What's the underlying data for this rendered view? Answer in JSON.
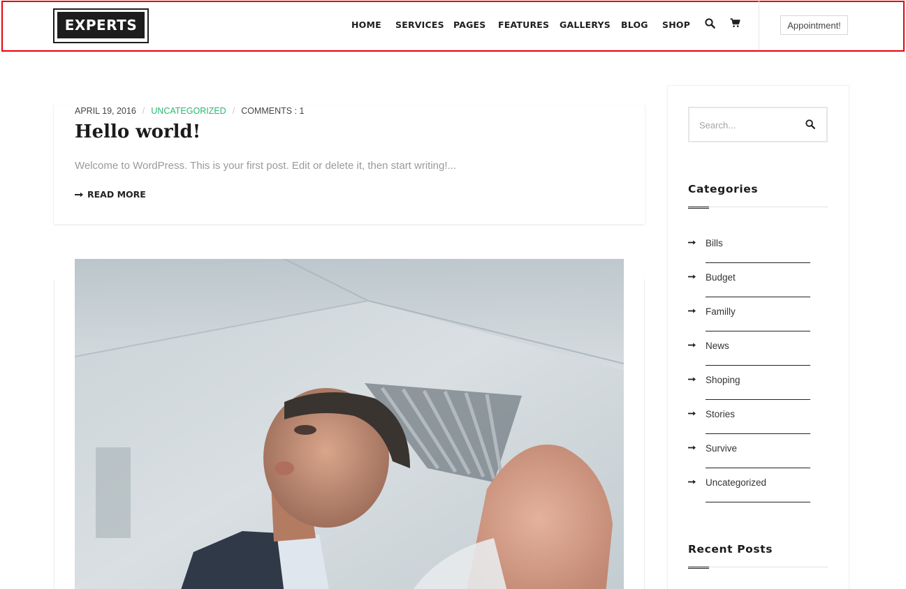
{
  "header": {
    "logo_text": "EXPERTS",
    "nav": [
      "HOME",
      "SERVICES",
      "PAGES",
      "FEATURES",
      "GALLERYS",
      "BLOG",
      "SHOP"
    ],
    "search_icon": "search-icon",
    "cart_icon": "cart-icon",
    "appointment_label": "Appointment!",
    "highlight_color": "#e8000b"
  },
  "post": {
    "date": "APRIL 19, 2016",
    "category": "UNCATEGORIZED",
    "comments": "COMMENTS : 1",
    "title": "Hello world!",
    "excerpt": "Welcome to WordPress. This is your first post. Edit or delete it, then start writing!...",
    "read_more": "READ MORE",
    "category_color": "#2bb673"
  },
  "post2": {
    "image_desc": "businessman-photo"
  },
  "sidebar": {
    "search_placeholder": "Search...",
    "categories_title": "Categories",
    "categories": [
      "Bills",
      "Budget",
      "Familly",
      "News",
      "Shoping",
      "Stories",
      "Survive",
      "Uncategorized"
    ],
    "recent_posts_title": "Recent Posts"
  }
}
